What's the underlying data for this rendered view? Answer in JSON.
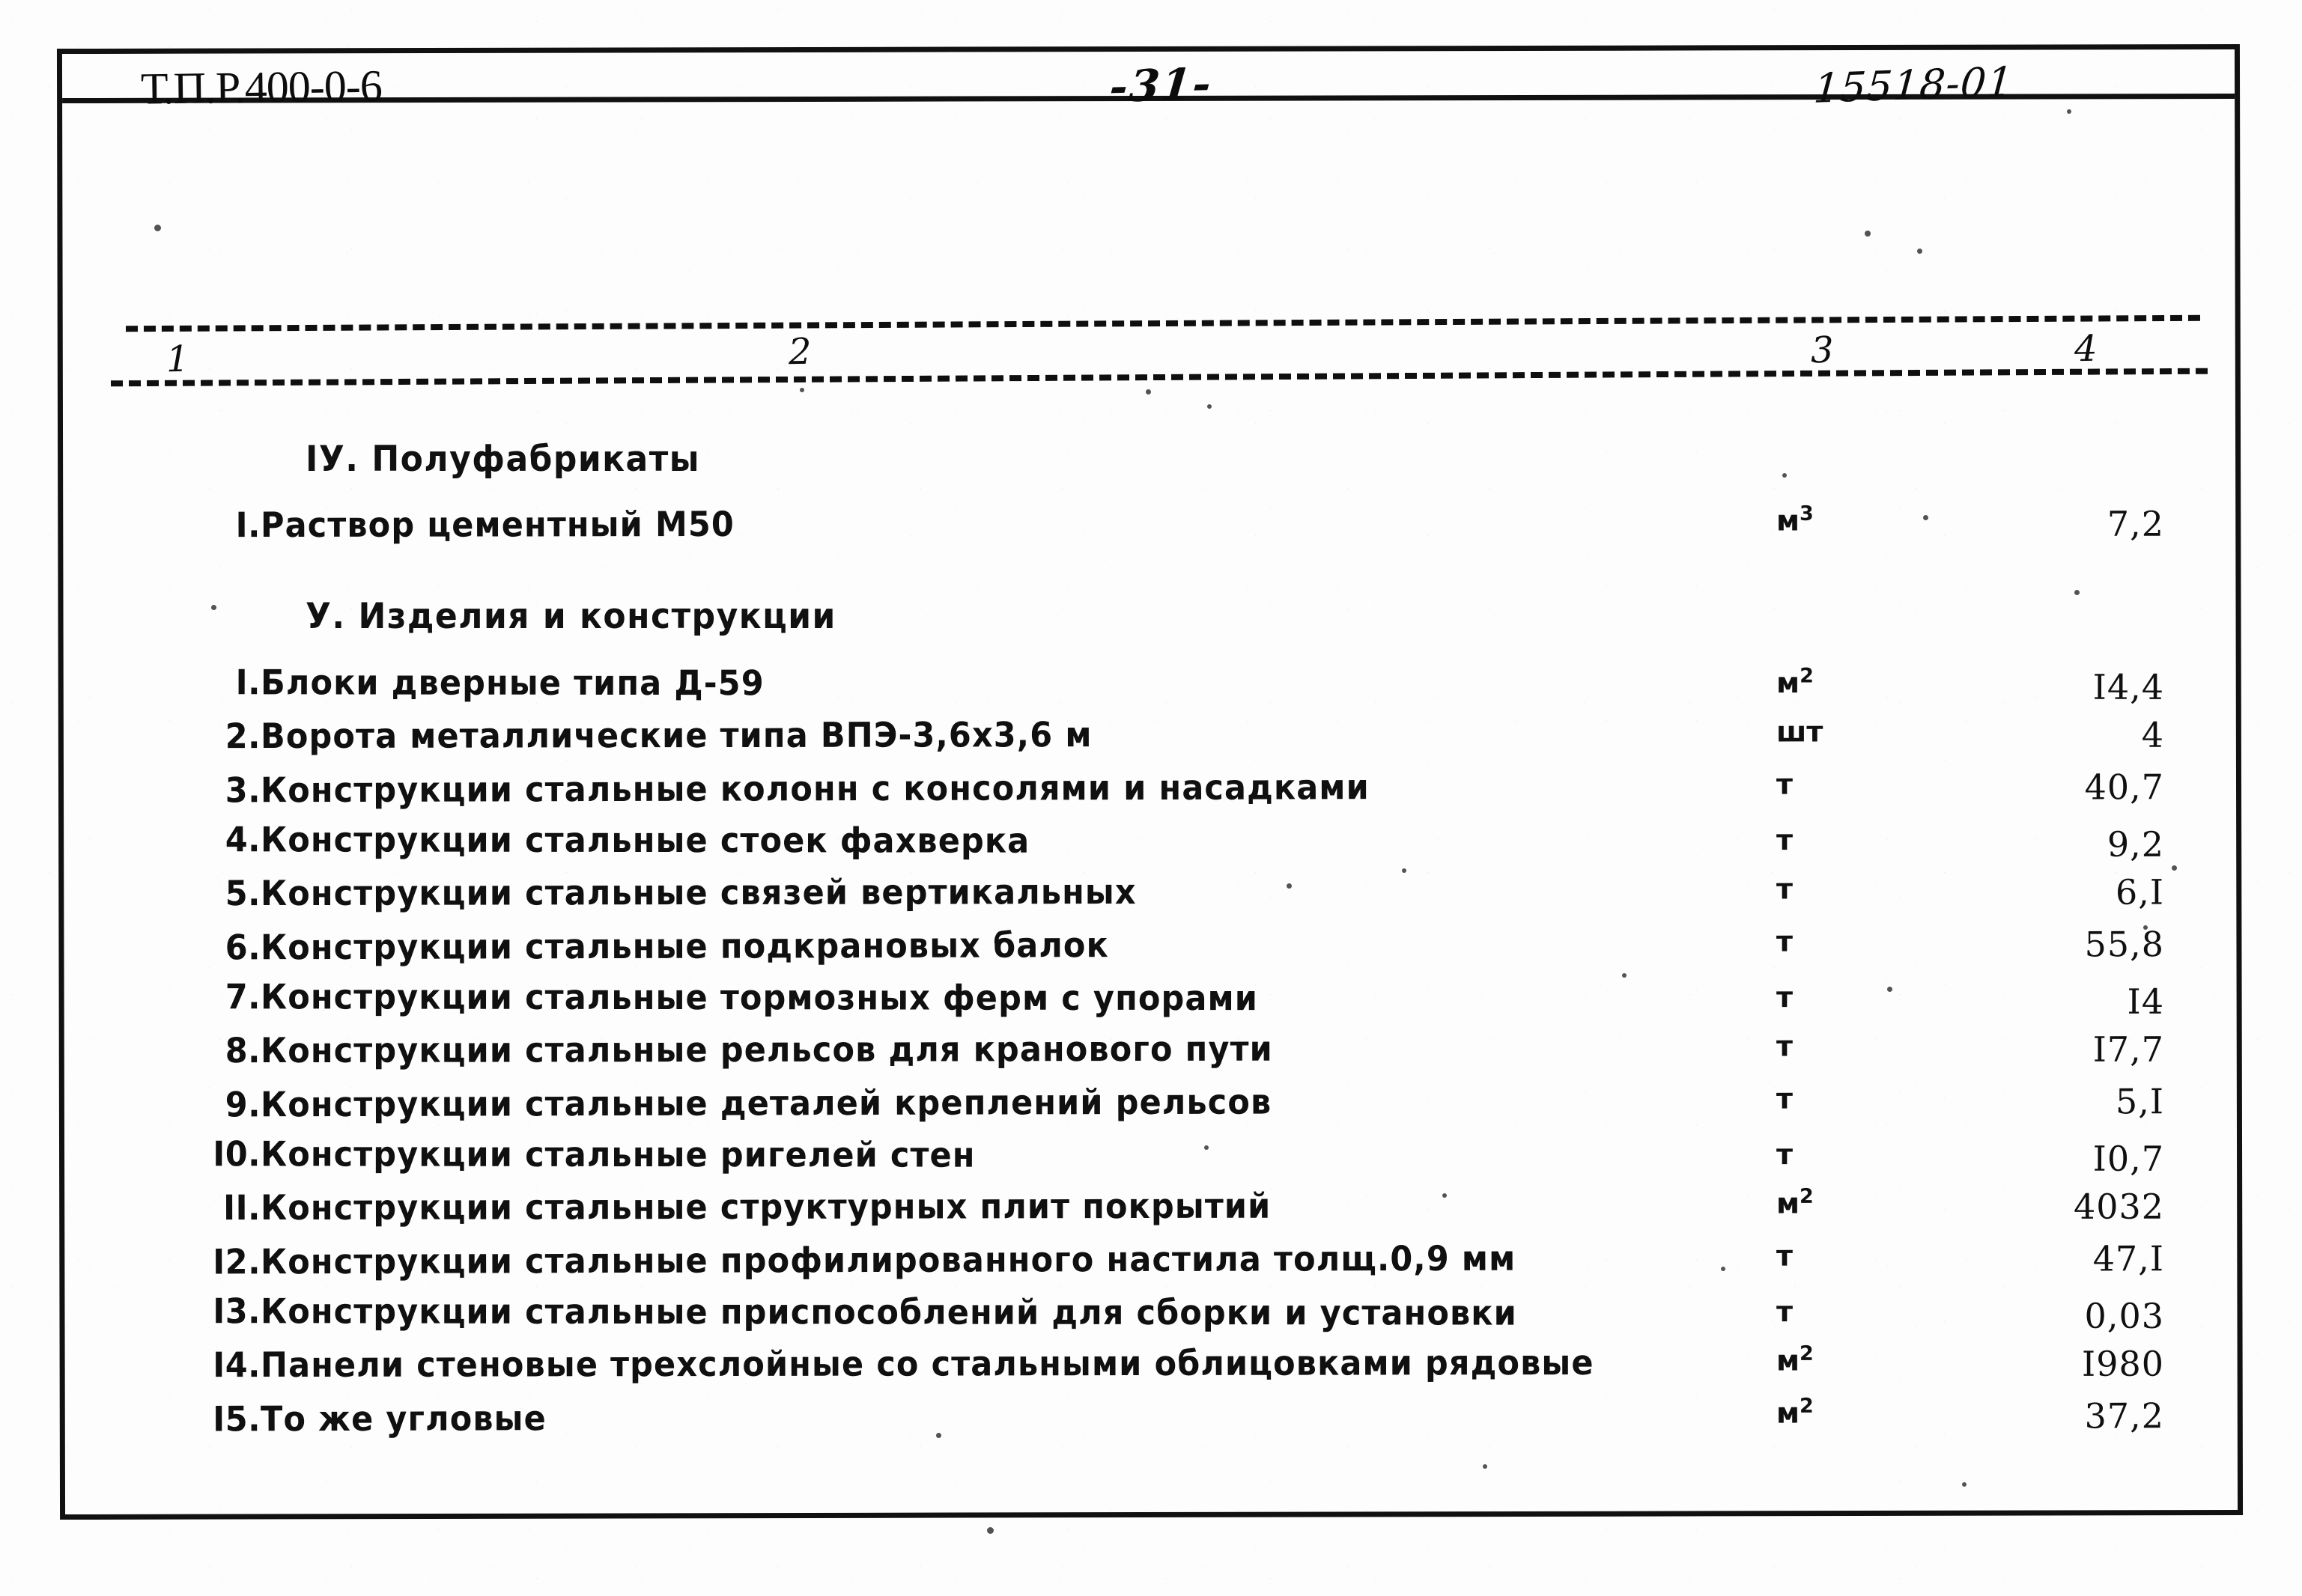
{
  "document": {
    "header": {
      "code_label": "Т.П.Р.400-0-6",
      "page_number": "-31-",
      "sheet_number": "15518-01"
    },
    "column_numbers": {
      "c1": "1",
      "c2": "2",
      "c3": "3",
      "c4": "4"
    },
    "sections": [
      {
        "heading": "IУ. Полуфабрикаты",
        "rows": [
          {
            "num": "I.",
            "name": "Раствор цементный М50",
            "unit": "м",
            "unit_sup": "3",
            "value": "7,2"
          }
        ]
      },
      {
        "heading": "У. Изделия    и конструкции",
        "rows": [
          {
            "num": "I.",
            "name": "Блоки дверные типа Д-59",
            "unit": "м",
            "unit_sup": "2",
            "value": "I4,4"
          },
          {
            "num": "2.",
            "name": "Ворота металлические типа ВПЭ-3,6х3,6 м",
            "unit": "шт",
            "unit_sup": "",
            "value": "4"
          },
          {
            "num": "3.",
            "name": "Конструкции стальные колонн с консолями и насадками",
            "unit": "т",
            "unit_sup": "",
            "value": "40,7"
          },
          {
            "num": "4.",
            "name": "Конструкции стальные стоек фахверка",
            "unit": "т",
            "unit_sup": "",
            "value": "9,2"
          },
          {
            "num": "5.",
            "name": "Конструкции стальные связей вертикальных",
            "unit": "т",
            "unit_sup": "",
            "value": "6,I"
          },
          {
            "num": "6.",
            "name": "Конструкции стальные подкрановых балок",
            "unit": "т",
            "unit_sup": "",
            "value": "55,8"
          },
          {
            "num": "7.",
            "name": "Конструкции стальные тормозных ферм с упорами",
            "unit": "т",
            "unit_sup": "",
            "value": "I4"
          },
          {
            "num": "8.",
            "name": "Конструкции стальные рельсов для кранового пути",
            "unit": "т",
            "unit_sup": "",
            "value": "I7,7"
          },
          {
            "num": "9.",
            "name": "Конструкции стальные деталей креплений рельсов",
            "unit": "т",
            "unit_sup": "",
            "value": "5,I"
          },
          {
            "num": "I0.",
            "name": "Конструкции стальные ригелей стен",
            "unit": "т",
            "unit_sup": "",
            "value": "I0,7"
          },
          {
            "num": "II.",
            "name": "Конструкции стальные структурных плит покрытий",
            "unit": "м",
            "unit_sup": "2",
            "value": "4032"
          },
          {
            "num": "I2.",
            "name": "Конструкции стальные профилированного настила толщ.0,9 мм",
            "unit": "т",
            "unit_sup": "",
            "value": "47,I"
          },
          {
            "num": "I3.",
            "name": "Конструкции стальные приспособлений для сборки и установки",
            "unit": "т",
            "unit_sup": "",
            "value": "0,03"
          },
          {
            "num": "I4.",
            "name": "Панели стеновые трехслойные со стальными облицовками рядовые",
            "unit": "м",
            "unit_sup": "2",
            "value": "I980"
          },
          {
            "num": "I5.",
            "name": "То же угловые",
            "unit": "м",
            "unit_sup": "2",
            "value": "37,2"
          }
        ]
      }
    ]
  }
}
